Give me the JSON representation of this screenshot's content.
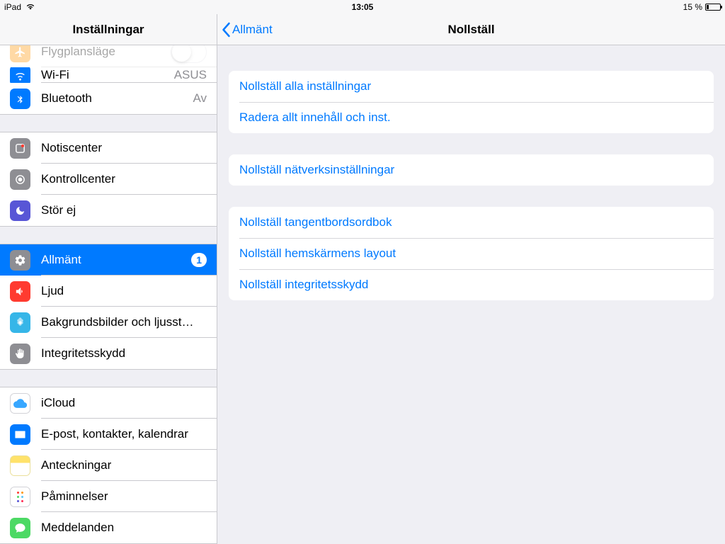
{
  "status": {
    "carrier": "iPad",
    "time": "13:05",
    "battery_text": "15 %"
  },
  "sidebar": {
    "title": "Inställningar",
    "items": {
      "airplane": {
        "label": "Flygplansläge"
      },
      "wifi": {
        "label": "Wi-Fi",
        "value": "ASUS"
      },
      "bluetooth": {
        "label": "Bluetooth",
        "value": "Av"
      },
      "notif": {
        "label": "Notiscenter"
      },
      "cc": {
        "label": "Kontrollcenter"
      },
      "dnd": {
        "label": "Stör ej"
      },
      "general": {
        "label": "Allmänt",
        "badge": "1"
      },
      "sound": {
        "label": "Ljud"
      },
      "wall": {
        "label": "Bakgrundsbilder och ljusst…"
      },
      "privacy": {
        "label": "Integritetsskydd"
      },
      "icloud": {
        "label": "iCloud"
      },
      "mail": {
        "label": "E-post, kontakter, kalendrar"
      },
      "notes": {
        "label": "Anteckningar"
      },
      "reminders": {
        "label": "Påminnelser"
      },
      "messages": {
        "label": "Meddelanden"
      }
    }
  },
  "detail": {
    "back_label": "Allmänt",
    "title": "Nollställ",
    "groups": [
      [
        {
          "label": "Nollställ alla inställningar"
        },
        {
          "label": "Radera allt innehåll och inst."
        }
      ],
      [
        {
          "label": "Nollställ nätverksinställningar"
        }
      ],
      [
        {
          "label": "Nollställ tangentbordsordbok"
        },
        {
          "label": "Nollställ hemskärmens layout"
        },
        {
          "label": "Nollställ integritetsskydd"
        }
      ]
    ]
  }
}
